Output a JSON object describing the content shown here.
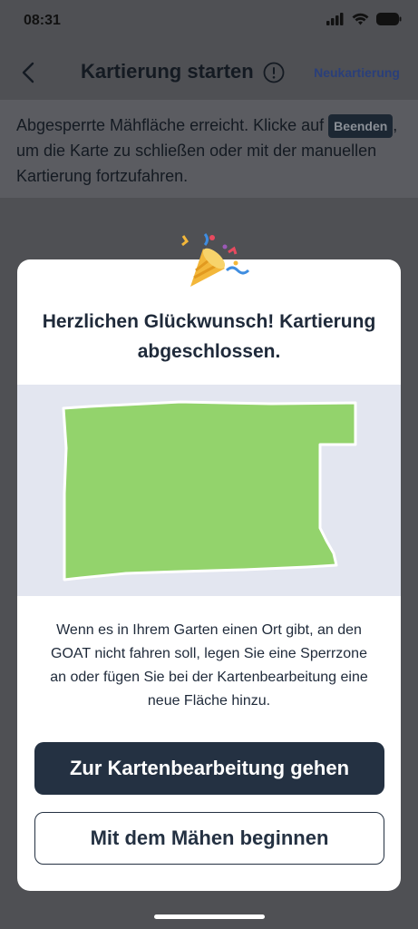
{
  "status": {
    "time": "08:31"
  },
  "nav": {
    "title": "Kartierung starten",
    "action": "Neukartierung"
  },
  "banner": {
    "text_before": "Abgesperrte Mähfläche erreicht. Klicke auf ",
    "pill": "Beenden",
    "text_after": ", um die Karte zu schließen oder mit der manuellen Kartierung fortzufahren."
  },
  "modal": {
    "title": "Herzlichen Glückwunsch! Kartierung abgeschlossen.",
    "text": "Wenn es in Ihrem Garten einen Ort gibt, an den GOAT nicht fahren soll, legen Sie eine Sperrzone an oder fügen Sie bei der Kartenbearbeitung eine neue Fläche hinzu.",
    "primary_button": "Zur Kartenbearbeitung gehen",
    "secondary_button": "Mit dem Mähen beginnen"
  },
  "colors": {
    "map_fill": "#93d36c",
    "map_background": "#e3e6f0",
    "primary_button": "#243142",
    "overlay": "#4f5054"
  },
  "icons": [
    "back-chevron-icon",
    "info-icon",
    "party-popper-icon",
    "signal-icon",
    "wifi-icon",
    "battery-icon"
  ]
}
